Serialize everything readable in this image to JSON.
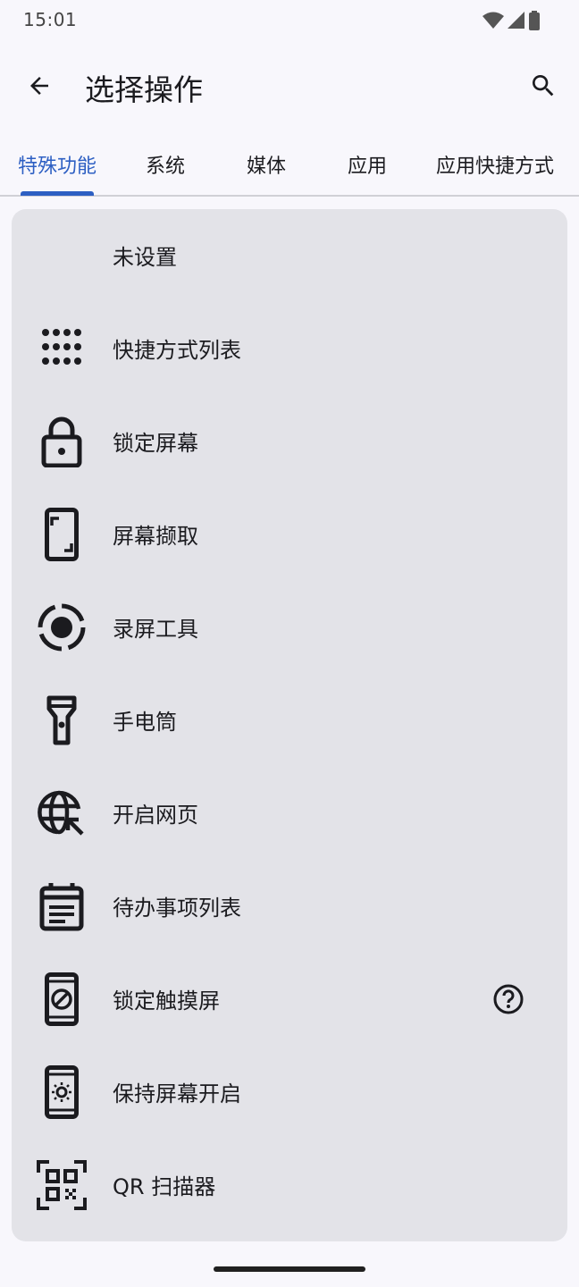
{
  "status_bar": {
    "time": "15:01"
  },
  "header": {
    "title": "选择操作"
  },
  "tabs": [
    {
      "label": "特殊功能",
      "active": true
    },
    {
      "label": "系统",
      "active": false
    },
    {
      "label": "媒体",
      "active": false
    },
    {
      "label": "应用",
      "active": false
    },
    {
      "label": "应用快捷方式",
      "active": false
    }
  ],
  "actions": [
    {
      "label": "未设置",
      "icon": "none"
    },
    {
      "label": "快捷方式列表",
      "icon": "apps-grid-icon"
    },
    {
      "label": "锁定屏幕",
      "icon": "lock-icon"
    },
    {
      "label": "屏幕撷取",
      "icon": "screenshot-icon"
    },
    {
      "label": "录屏工具",
      "icon": "screen-record-icon"
    },
    {
      "label": "手电筒",
      "icon": "flashlight-icon"
    },
    {
      "label": "开启网页",
      "icon": "open-web-icon"
    },
    {
      "label": "待办事项列表",
      "icon": "todo-list-icon"
    },
    {
      "label": "锁定触摸屏",
      "icon": "touch-lock-icon",
      "help": true
    },
    {
      "label": "保持屏幕开启",
      "icon": "screen-on-icon"
    },
    {
      "label": "QR 扫描器",
      "icon": "qr-scanner-icon"
    }
  ],
  "colors": {
    "accent": "#2d5fc3",
    "card": "#e3e3e8",
    "background": "#f8f7fc"
  }
}
